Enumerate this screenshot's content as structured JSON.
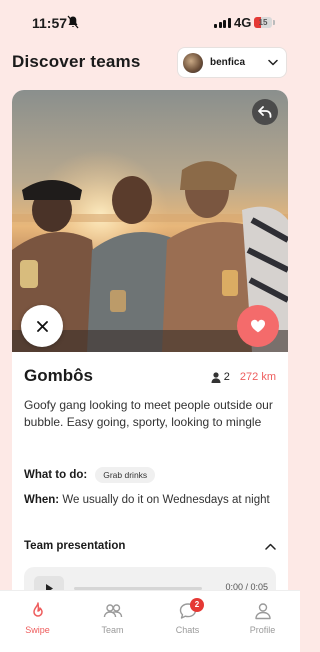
{
  "status_bar": {
    "time": "11:57",
    "network": "4G",
    "battery": "15"
  },
  "header": {
    "title": "Discover teams",
    "team_selector": {
      "value": "benfica"
    }
  },
  "card": {
    "team_name": "Gombôs",
    "members": "2",
    "distance": "272 km",
    "description": "Goofy gang looking to meet people outside our bubble. Easy going, sporty, looking to mingle",
    "what_label": "What to do:",
    "activity": "Grab drinks",
    "when_label": "When:",
    "when_text": "We usually do it on Wednesdays at night",
    "presentation_label": "Team presentation",
    "audio_time": "0:00 / 0:05"
  },
  "nav": [
    {
      "label": "Swipe",
      "icon": "flame-icon",
      "active": true
    },
    {
      "label": "Team",
      "icon": "people-icon"
    },
    {
      "label": "Chats",
      "icon": "chat-icon",
      "badge": "2"
    },
    {
      "label": "Profile",
      "icon": "person-icon"
    }
  ],
  "colors": {
    "accent": "#f46b6b",
    "background": "#fde9e6",
    "badge": "#e53935"
  }
}
